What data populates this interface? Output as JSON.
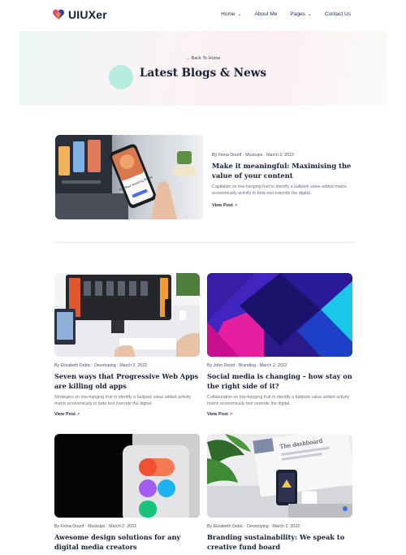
{
  "header": {
    "logo_text": "UIUXer",
    "nav": [
      {
        "label": "Home",
        "has_dropdown": true
      },
      {
        "label": "About Me",
        "has_dropdown": false
      },
      {
        "label": "Pages",
        "has_dropdown": true
      },
      {
        "label": "Contact Us",
        "has_dropdown": false
      }
    ]
  },
  "hero": {
    "back_link": "← Back To Home",
    "title": "Latest Blogs & News"
  },
  "featured": {
    "meta": "By Fiona Dourif  ·  Mockups  ·  March 2, 2022",
    "title": "Make it meaningful: Maximising the value of your content",
    "description": "Capitalize on low-hanging fruit to identify a ballpark value added matrix economically activity to beta test override the digital.",
    "view_label": "View Post",
    "view_icon": "↗"
  },
  "posts": [
    {
      "meta": "By Elizabeth Debic  ·  Developing  ·  March 2, 2022",
      "title": "Seven ways that Progressive Web Apps are killing old apps",
      "description": "Strategies on low-hanging fruit to identify a ballpark value added activity matrix economically to beta test override the digital.",
      "view_label": "View Post",
      "view_icon": "↗"
    },
    {
      "meta": "By John Dovid  ·  Branding  ·  March 2, 2022",
      "title": "Social media is changing – how stay on the right side of it?",
      "description": "Collaborative on low-hanging fruit to identify a ballpark value added activity matrix economically test override the digital.",
      "view_label": "View Post",
      "view_icon": "↗"
    },
    {
      "meta": "By Fiona Dourif  ·  Mockups  ·  March 2, 2022",
      "title": "Awesome design solutions for any digital media creators"
    },
    {
      "meta": "By Elizabeth Debic  ·  Developing  ·  March 2, 2022",
      "title": "Branding sustainability: We speak to creative fund board"
    }
  ],
  "image_text": {
    "phone_caption": "The Most Amazing Places",
    "dashboard_caption": "The dashboard"
  },
  "colors": {
    "accent_pink": "#e3487a",
    "navy": "#17203a",
    "mint": "#b9ece0"
  }
}
